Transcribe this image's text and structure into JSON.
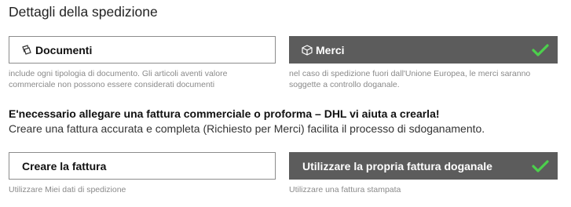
{
  "section_title": "Dettagli della spedizione",
  "shipment_type": {
    "documents": {
      "label": "Documenti",
      "icon": "documents-icon",
      "hint": "include ogni tipologia di documento. Gli articoli aventi valore commerciale non possono essere considerati documenti",
      "selected": false
    },
    "goods": {
      "label": "Merci",
      "icon": "box-icon",
      "hint": "nel caso di spedizione fuori dall'Unione Europea, le merci saranno soggette a controllo doganale.",
      "selected": true
    }
  },
  "invoice_notice": {
    "heading": "E'necessario allegare una fattura commerciale o proforma – DHL vi aiuta a crearla!",
    "text": "Creare una fattura accurata e completa (Richiesto per Merci) facilita il processo di sdoganamento."
  },
  "invoice_options": {
    "create": {
      "label": "Creare la fattura",
      "hint": "Utilizzare Miei dati di spedizione",
      "selected": false
    },
    "own": {
      "label": "Utilizzare la propria fattura doganale",
      "hint": "Utilizzare una fattura stampata",
      "selected": true
    }
  },
  "colors": {
    "selected_bg": "#5c5c5c",
    "check": "#4cd04c",
    "hint": "#8a8a8a",
    "border": "#8c8c8c"
  }
}
